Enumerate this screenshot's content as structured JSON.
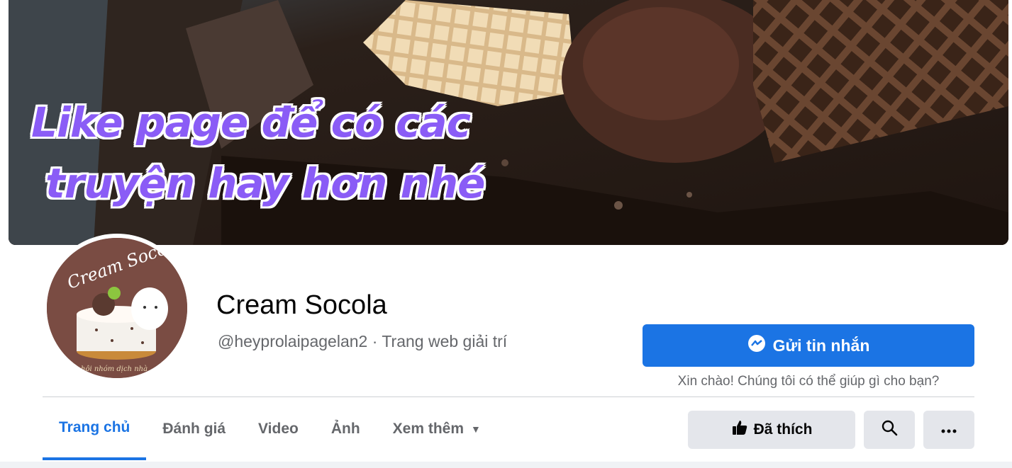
{
  "cover": {
    "overlay_line1": "Like page để có các",
    "overlay_line2": "truyện hay hơn nhé"
  },
  "profile": {
    "avatar_text_top": "Cream Socola",
    "avatar_text_bottom": "hội nhóm dịch nhà",
    "name": "Cream Socola",
    "subtitle": "@heyprolaipagelan2 · Trang web giải trí"
  },
  "actions": {
    "message_label": "Gửi tin nhắn",
    "message_hint": "Xin chào! Chúng tôi có thể giúp gì cho bạn?",
    "liked_label": "Đã thích"
  },
  "tabs": [
    {
      "label": "Trang chủ",
      "active": true
    },
    {
      "label": "Đánh giá",
      "active": false
    },
    {
      "label": "Video",
      "active": false
    },
    {
      "label": "Ảnh",
      "active": false
    },
    {
      "label": "Xem thêm",
      "active": false
    }
  ],
  "colors": {
    "accent": "#1b74e4",
    "overlay_text": "#8a5cf6"
  }
}
